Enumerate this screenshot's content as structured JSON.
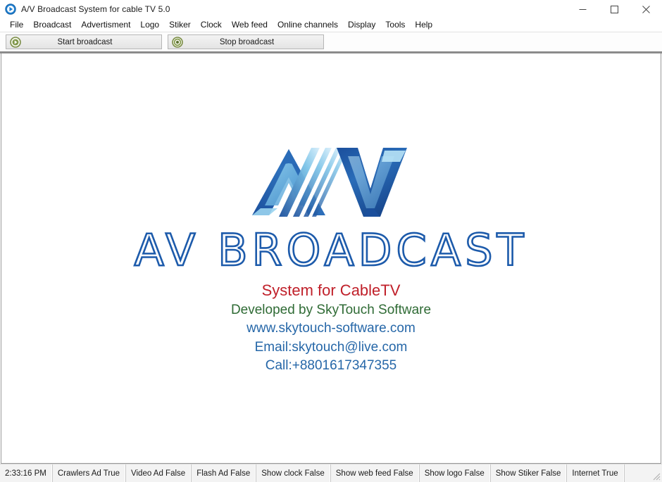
{
  "window": {
    "title": "A/V Broadcast System for cable TV 5.0",
    "app_icon": "play-circle-icon",
    "controls": {
      "minimize_label": "—",
      "maximize_label": "□",
      "close_label": "✕"
    }
  },
  "menu": {
    "items": [
      {
        "label": "File"
      },
      {
        "label": "Broadcast"
      },
      {
        "label": "Advertisment"
      },
      {
        "label": "Logo"
      },
      {
        "label": "Stiker"
      },
      {
        "label": "Clock"
      },
      {
        "label": "Web feed"
      },
      {
        "label": "Online channels"
      },
      {
        "label": "Display"
      },
      {
        "label": "Tools"
      },
      {
        "label": "Help"
      }
    ]
  },
  "toolbar": {
    "start_label": "Start broadcast",
    "start_icon": "play-circle-green-icon",
    "stop_label": "Stop broadcast",
    "stop_icon": "stop-circle-green-icon"
  },
  "splash": {
    "logo_alt": "AV logo",
    "wordmark": "AV BROADCAST",
    "system_line": "System for CableTV",
    "developer_line": "Developed by SkyTouch Software",
    "website_line": "www.skytouch-software.com",
    "email_line": "Email:skytouch@live.com",
    "call_line": "Call:+8801617347355",
    "colors": {
      "logo_blue_dark": "#1b4f9c",
      "logo_blue_light": "#8fd3f0",
      "wordmark_blue": "#1d5bab",
      "system_red": "#c0202a",
      "developer_green": "#2f6b35",
      "contact_blue": "#2667a8"
    }
  },
  "status_bar": {
    "panels": [
      {
        "label": "2:33:16 PM",
        "name": "clock"
      },
      {
        "label": "Crawlers Ad True",
        "name": "crawlers-ad"
      },
      {
        "label": "Video Ad False",
        "name": "video-ad"
      },
      {
        "label": "Flash Ad False",
        "name": "flash-ad"
      },
      {
        "label": "Show clock False",
        "name": "show-clock"
      },
      {
        "label": "Show web feed False",
        "name": "show-web-feed"
      },
      {
        "label": "Show logo False",
        "name": "show-logo"
      },
      {
        "label": "Show Stiker False",
        "name": "show-stiker"
      },
      {
        "label": "Internet True",
        "name": "internet"
      }
    ]
  }
}
